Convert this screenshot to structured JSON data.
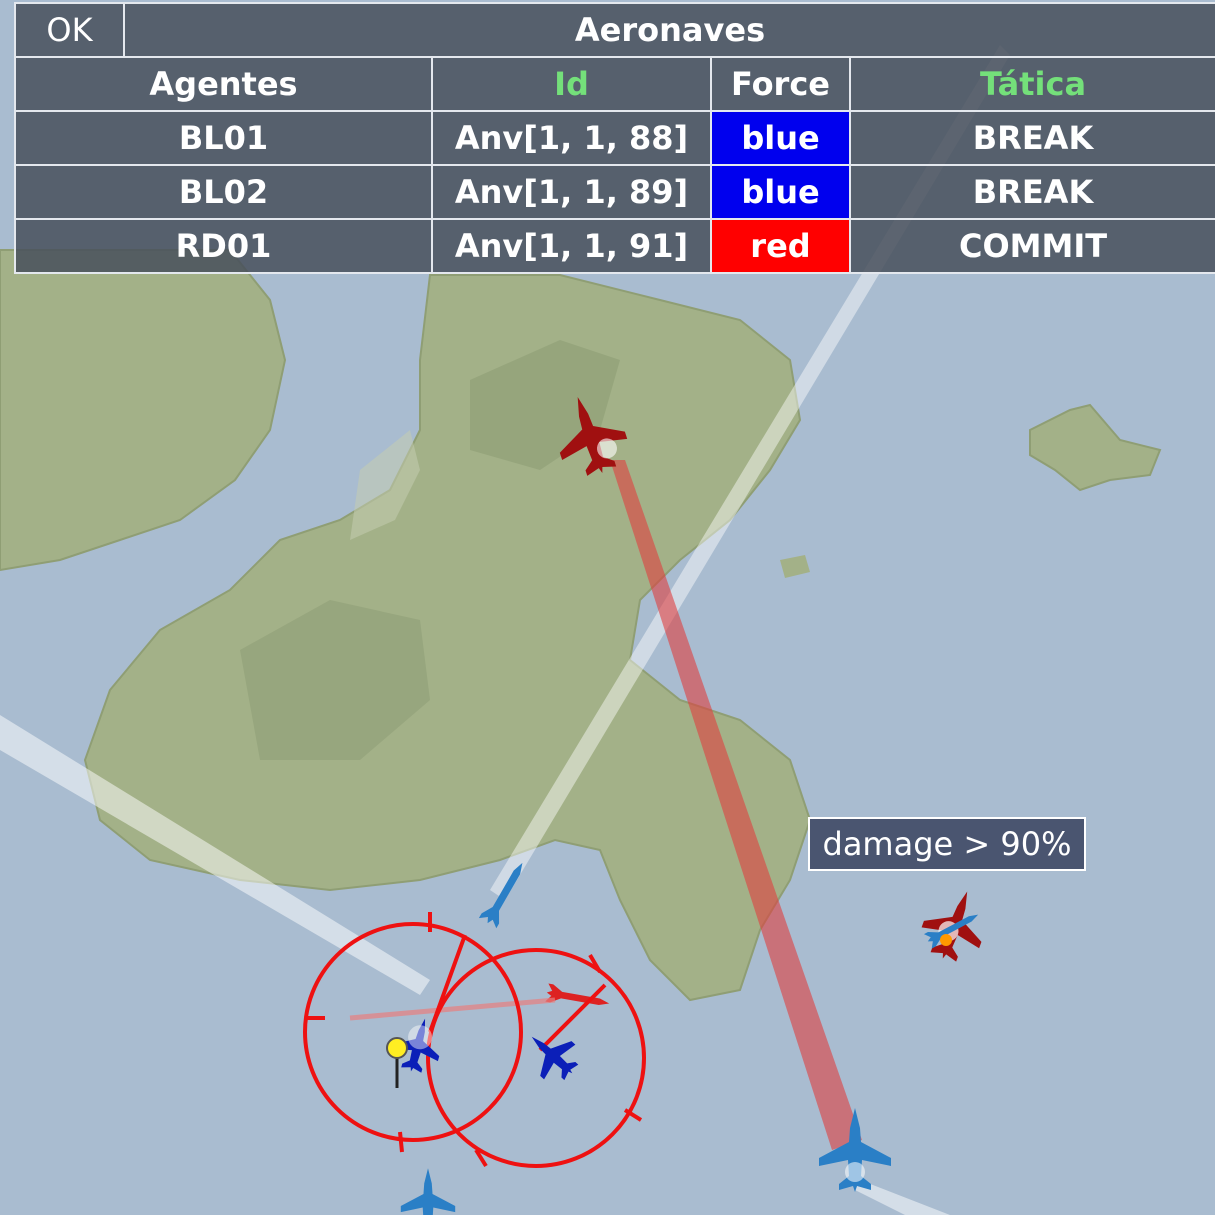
{
  "panel": {
    "ok_label": "OK",
    "title": "Aeronaves",
    "columns": {
      "agentes": "Agentes",
      "id": "Id",
      "force": "Force",
      "tatica": "Tática"
    },
    "rows": [
      {
        "agent": "BL01",
        "id": "Anv[1, 1, 88]",
        "force": "blue",
        "tactic": "BREAK"
      },
      {
        "agent": "BL02",
        "id": "Anv[1, 1, 89]",
        "force": "blue",
        "tactic": "BREAK"
      },
      {
        "agent": "RD01",
        "id": "Anv[1, 1, 91]",
        "force": "red",
        "tactic": "COMMIT"
      }
    ]
  },
  "tooltip": {
    "text": "damage > 90%"
  },
  "colors": {
    "sea": "#a9bcd0",
    "land": "#a3b188",
    "panel_bg": "#48505c",
    "header_accent": "#74e07a",
    "force_blue": "#0000ee",
    "force_red": "#ff0000",
    "red_aircraft": "#a01010",
    "blue_aircraft": "#2a7fc6",
    "dark_blue_aircraft": "#0b1fb8",
    "range_ring": "#ee1111"
  },
  "icons": [
    "red-jet-icon",
    "blue-jet-icon",
    "blue-missile-icon",
    "red-missile-icon",
    "waypoint-marker-icon",
    "range-ring-icon"
  ]
}
